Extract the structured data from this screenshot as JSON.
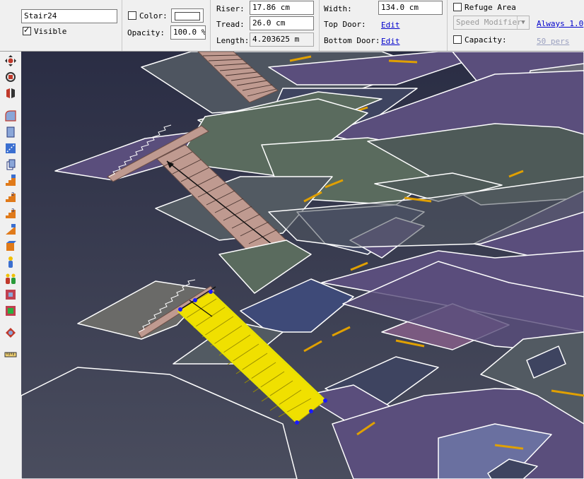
{
  "object": {
    "name": "Stair24",
    "visible_label": "Visible",
    "visible_checked": true,
    "color_label": "Color:",
    "color_checked": false,
    "opacity_label": "Opacity:",
    "opacity_value": "100.0 %"
  },
  "dimensions": {
    "riser_label": "Riser:",
    "riser_value": "17.86 cm",
    "tread_label": "Tread:",
    "tread_value": "26.0 cm",
    "length_label": "Length:",
    "length_value": "4.203625 m"
  },
  "doors": {
    "width_label": "Width:",
    "width_value": "134.0 cm",
    "top_door_label": "Top Door:",
    "top_door_link": "Edit",
    "bottom_door_label": "Bottom Door:",
    "bottom_door_link": "Edit"
  },
  "refuge": {
    "refuge_label": "Refuge Area",
    "refuge_checked": false,
    "speed_modifier_placeholder": "Speed Modifier",
    "always_link": "Always 1.0",
    "capacity_label": "Capacity:",
    "capacity_checked": false,
    "capacity_link": "50 pers"
  },
  "toolbar": {
    "tools": [
      "move-icon",
      "orbit-icon",
      "zoom-icon",
      "room-icon",
      "obstruction-icon",
      "door-icon",
      "stair-icon",
      "stair-landing-icon",
      "stair-up-icon",
      "stair-down-icon",
      "ramp-icon",
      "exit-icon",
      "occupant-icon",
      "group-icon",
      "target-icon",
      "region-icon",
      "camera-icon",
      "measure-icon"
    ]
  },
  "colors": {
    "room_purple": "#5a4e7c",
    "room_teal": "#4e5a58",
    "stair_brown": "#bf9a90",
    "selected_yellow": "#f0e000",
    "door_orange": "#e0a000",
    "background": "#3a3d52"
  }
}
